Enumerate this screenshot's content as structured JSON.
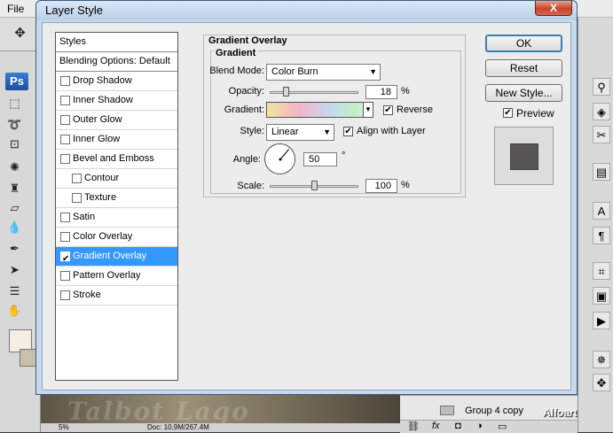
{
  "app": {
    "menu": [
      "File"
    ],
    "logo": "Ps",
    "tools": [
      "move-tool",
      "marquee-tool",
      "lasso-tool",
      "crop-tool",
      "heal-tool",
      "stamp-tool",
      "eraser-tool",
      "blur-tool",
      "pen-tool",
      "select-tool",
      "notes-tool",
      "hand-tool"
    ],
    "canvas_text": "Talbot Lago",
    "layers": {
      "group_label": "Group 4 copy"
    },
    "status_text": "Doc: 10.9M/267.4M",
    "status_zoom": "5%",
    "watermark": "Alfoart.com"
  },
  "dialog": {
    "title": "Layer Style",
    "close_glyph": "X",
    "styles": [
      {
        "label": "Styles",
        "type": "header",
        "checked": false
      },
      {
        "label": "Blending Options: Default",
        "type": "header",
        "checked": false
      },
      {
        "label": "Drop Shadow",
        "checked": false
      },
      {
        "label": "Inner Shadow",
        "checked": false
      },
      {
        "label": "Outer Glow",
        "checked": false
      },
      {
        "label": "Inner Glow",
        "checked": false
      },
      {
        "label": "Bevel and Emboss",
        "checked": false
      },
      {
        "label": "Contour",
        "checked": false,
        "indent": true
      },
      {
        "label": "Texture",
        "checked": false,
        "indent": true
      },
      {
        "label": "Satin",
        "checked": false
      },
      {
        "label": "Color Overlay",
        "checked": false
      },
      {
        "label": "Gradient Overlay",
        "checked": true,
        "selected": true
      },
      {
        "label": "Pattern Overlay",
        "checked": false
      },
      {
        "label": "Stroke",
        "checked": false
      }
    ],
    "section_title": "Gradient Overlay",
    "group_title": "Gradient",
    "blend_mode": {
      "label": "Blend Mode:",
      "value": "Color Burn"
    },
    "opacity": {
      "label": "Opacity:",
      "value": "18",
      "unit": "%",
      "level": 0.18
    },
    "gradient": {
      "label": "Gradient:",
      "reverse_label": "Reverse",
      "reverse_checked": true
    },
    "style": {
      "label": "Style:",
      "value": "Linear",
      "align_label": "Align with Layer",
      "align_checked": true
    },
    "angle": {
      "label": "Angle:",
      "value": "50",
      "unit": "°",
      "degrees": 50
    },
    "scale": {
      "label": "Scale:",
      "value": "100",
      "unit": "%",
      "level": 0.5
    },
    "buttons": {
      "ok": "OK",
      "reset": "Reset",
      "new_style": "New Style...",
      "preview": "Preview"
    },
    "preview_checked": true
  }
}
